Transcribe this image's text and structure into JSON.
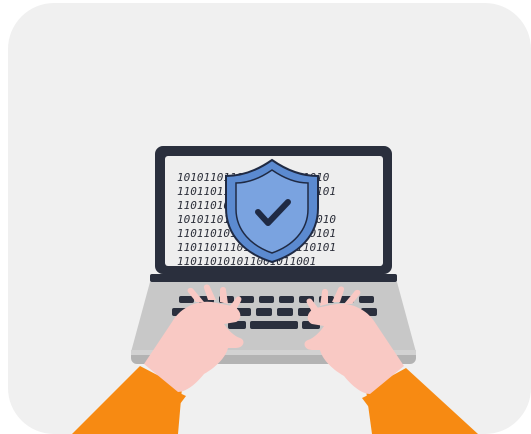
{
  "illustration": {
    "subject": "hands-typing-on-laptop-with-security-shield",
    "colors": {
      "background": "#f0f0f0",
      "laptop_body": "#2a2f3d",
      "screen": "#eeeeee",
      "keyboard_deck": "#c8c8c8",
      "keys": "#2a2f3d",
      "shield_fill": "#5b8ad0",
      "shield_inner": "#7aa3e0",
      "check": "#1f2a44",
      "skin": "#f9c9c4",
      "sleeve": "#f78a12"
    },
    "screen_binary": [
      "10101101110101010111010",
      "110110111010111011110101",
      "110110101100111001001",
      "101011011101111011111010",
      "110110101101101011110101",
      "110110111011101101110101",
      "110110101011001011001"
    ]
  }
}
